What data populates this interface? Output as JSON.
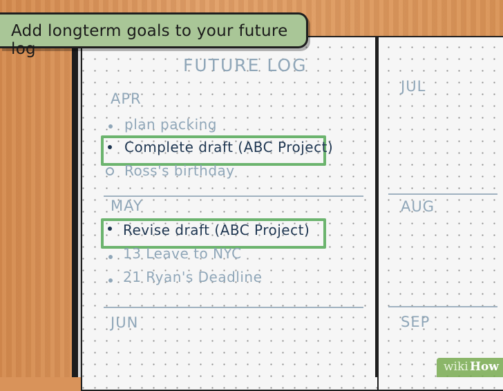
{
  "banner": {
    "text": "Add longterm goals to your future log"
  },
  "log": {
    "title": "FUTURE LOG",
    "months": {
      "apr": {
        "label": "APR",
        "items": [
          "plan packing",
          "Complete draft (ABC Project)",
          "Ross's birthday"
        ]
      },
      "may": {
        "label": "MAY",
        "items": [
          "Revise draft (ABC Project)",
          "13 Leave to NYC",
          "21 Ryan's Deadline"
        ]
      },
      "jun": {
        "label": "JUN"
      },
      "jul": {
        "label": "JUL"
      },
      "aug": {
        "label": "AUG"
      },
      "sep": {
        "label": "SEP"
      }
    }
  },
  "watermark": {
    "wiki": "wiki",
    "how": "How"
  },
  "colors": {
    "highlight": "#6cb46e",
    "banner": "#a9c697",
    "ink_dark": "#1d3550",
    "ink_faint": "#8fa6b8"
  }
}
